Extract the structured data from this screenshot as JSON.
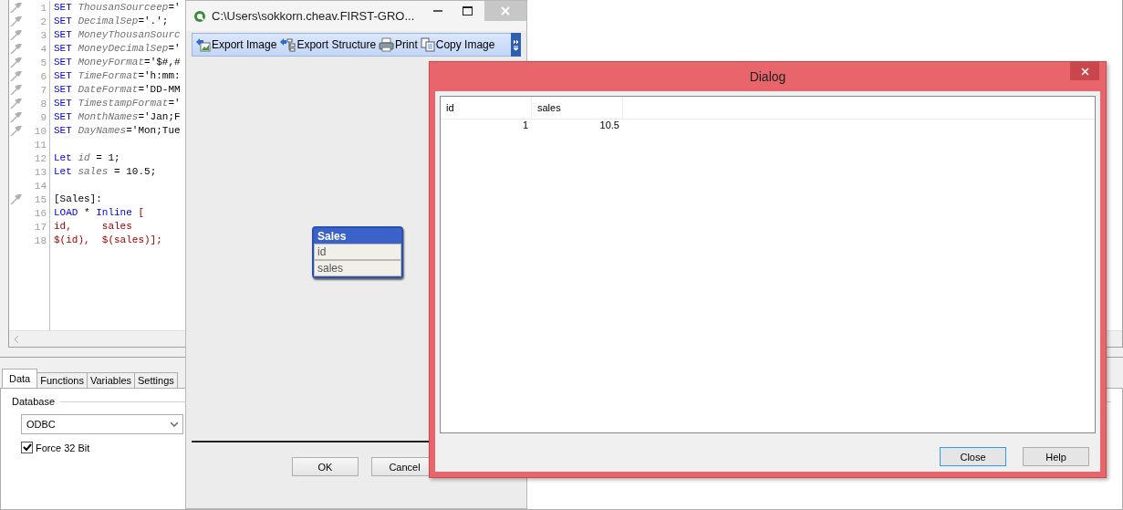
{
  "editor": {
    "lines": [
      {
        "number": "1",
        "marker": true,
        "tokens": [
          {
            "kind": "keyword",
            "text": "SET "
          },
          {
            "kind": "name",
            "text": "ThousanSourceep"
          },
          {
            "kind": "plain",
            "text": "='"
          }
        ]
      },
      {
        "number": "2",
        "marker": true,
        "tokens": [
          {
            "kind": "keyword",
            "text": "SET "
          },
          {
            "kind": "name",
            "text": "DecimalSep"
          },
          {
            "kind": "plain",
            "text": "='.';"
          }
        ]
      },
      {
        "number": "3",
        "marker": true,
        "tokens": [
          {
            "kind": "keyword",
            "text": "SET "
          },
          {
            "kind": "name",
            "text": "MoneyThousanSourc"
          }
        ]
      },
      {
        "number": "4",
        "marker": true,
        "tokens": [
          {
            "kind": "keyword",
            "text": "SET "
          },
          {
            "kind": "name",
            "text": "MoneyDecimalSep"
          },
          {
            "kind": "plain",
            "text": "='"
          }
        ]
      },
      {
        "number": "5",
        "marker": true,
        "tokens": [
          {
            "kind": "keyword",
            "text": "SET "
          },
          {
            "kind": "name",
            "text": "MoneyFormat"
          },
          {
            "kind": "plain",
            "text": "='$#,#"
          }
        ]
      },
      {
        "number": "6",
        "marker": true,
        "tokens": [
          {
            "kind": "keyword",
            "text": "SET "
          },
          {
            "kind": "name",
            "text": "TimeFormat"
          },
          {
            "kind": "plain",
            "text": "='h:mm:"
          }
        ]
      },
      {
        "number": "7",
        "marker": true,
        "tokens": [
          {
            "kind": "keyword",
            "text": "SET "
          },
          {
            "kind": "name",
            "text": "DateFormat"
          },
          {
            "kind": "plain",
            "text": "='DD-MM"
          }
        ]
      },
      {
        "number": "8",
        "marker": true,
        "tokens": [
          {
            "kind": "keyword",
            "text": "SET "
          },
          {
            "kind": "name",
            "text": "TimestampFormat"
          },
          {
            "kind": "plain",
            "text": "='"
          }
        ]
      },
      {
        "number": "9",
        "marker": true,
        "tokens": [
          {
            "kind": "keyword",
            "text": "SET "
          },
          {
            "kind": "name",
            "text": "MonthNames"
          },
          {
            "kind": "plain",
            "text": "='Jan;F"
          }
        ]
      },
      {
        "number": "10",
        "marker": true,
        "tokens": [
          {
            "kind": "keyword",
            "text": "SET "
          },
          {
            "kind": "name",
            "text": "DayNames"
          },
          {
            "kind": "plain",
            "text": "='Mon;Tue"
          }
        ]
      },
      {
        "number": "11",
        "marker": false
      },
      {
        "number": "12",
        "marker": false,
        "tokens": [
          {
            "kind": "keyword",
            "text": "Let "
          },
          {
            "kind": "name",
            "text": "id"
          },
          {
            "kind": "plain",
            "text": " = 1;"
          }
        ]
      },
      {
        "number": "13",
        "marker": false,
        "tokens": [
          {
            "kind": "keyword",
            "text": "Let "
          },
          {
            "kind": "name",
            "text": "sales"
          },
          {
            "kind": "plain",
            "text": " = 10.5;"
          }
        ]
      },
      {
        "number": "14",
        "marker": false
      },
      {
        "number": "15",
        "marker": true,
        "tokens": [
          {
            "kind": "plain",
            "text": "[Sales]:"
          }
        ]
      },
      {
        "number": "16",
        "marker": false,
        "tokens": [
          {
            "kind": "keyword",
            "text": "LOAD"
          },
          {
            "kind": "plain",
            "text": " * "
          },
          {
            "kind": "keyword",
            "text": "Inline"
          },
          {
            "kind": "string",
            "text": " ["
          }
        ]
      },
      {
        "number": "17",
        "marker": false,
        "tokens": [
          {
            "kind": "string",
            "text": "id,     sales"
          }
        ]
      },
      {
        "number": "18",
        "marker": false,
        "tokens": [
          {
            "kind": "string",
            "text": "$(id),  $(sales)];"
          }
        ]
      }
    ]
  },
  "tabs": [
    {
      "label": "Data",
      "selected": true
    },
    {
      "label": "Functions",
      "selected": false
    },
    {
      "label": "Variables",
      "selected": false
    },
    {
      "label": "Settings",
      "selected": false
    }
  ],
  "data_tab": {
    "group_label": "Database",
    "database_select": "ODBC",
    "force_32_bit": {
      "label": "Force 32 Bit",
      "checked": true
    }
  },
  "viewer_window": {
    "title": "C:\\Users\\sokkorn.cheav.FIRST-GRO...",
    "toolbar": [
      {
        "kind": "export-image",
        "label": "Export Image"
      },
      {
        "kind": "export-structure",
        "label": "Export Structure"
      },
      {
        "kind": "print",
        "label": "Print"
      },
      {
        "kind": "copy",
        "label": "Copy Image"
      }
    ],
    "table_box": {
      "title": "Sales",
      "fields": [
        "id",
        "sales"
      ]
    },
    "buttons": [
      "OK",
      "Cancel"
    ]
  },
  "dialog": {
    "title": "Dialog",
    "table": {
      "columns": [
        "id",
        "sales"
      ],
      "rows": [
        [
          "1",
          "10.5"
        ]
      ]
    },
    "buttons": [
      {
        "label": "Close",
        "focused": true
      },
      {
        "label": "Help",
        "focused": false
      }
    ]
  }
}
